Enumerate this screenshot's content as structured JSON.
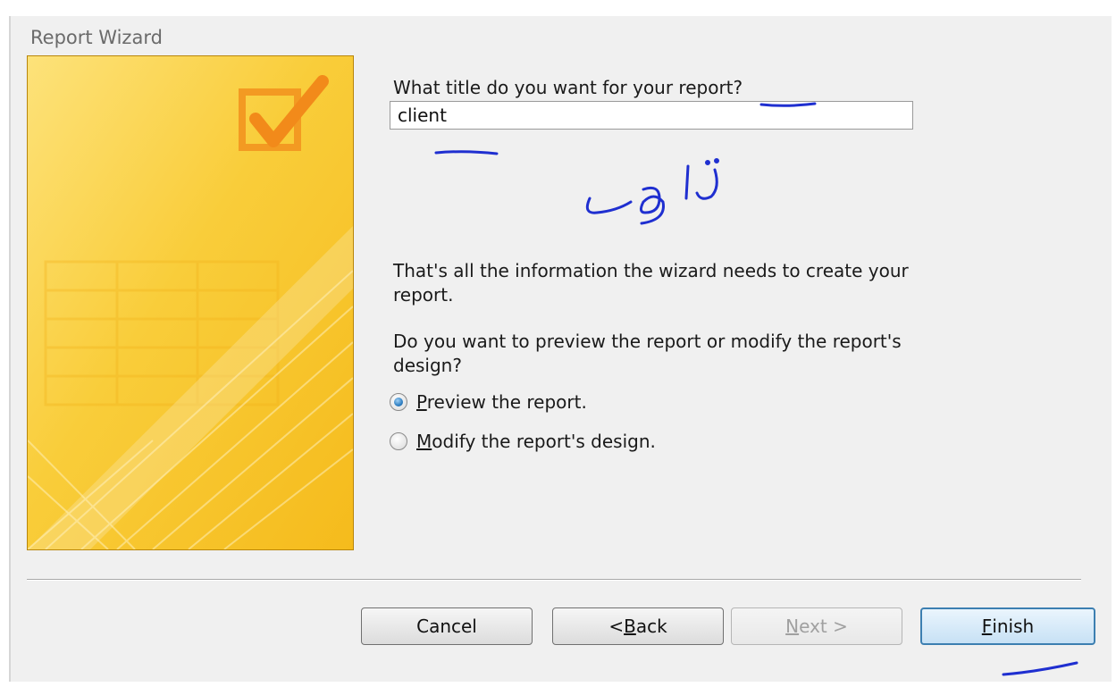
{
  "window": {
    "title": "Report Wizard"
  },
  "prompts": {
    "title_question": "What title do you want for your report?",
    "info_line1": "That's all the information the wizard needs to create your",
    "info_line2": "report.",
    "preview_question_line1": "Do you want to preview the report or modify the report's",
    "preview_question_line2": "design?"
  },
  "title_field": {
    "value": "client"
  },
  "options": [
    {
      "prefix": "",
      "hotkey": "P",
      "rest": "review the report.",
      "checked": true
    },
    {
      "prefix": "",
      "hotkey": "M",
      "rest": "odify the report's design.",
      "checked": false
    }
  ],
  "buttons": {
    "cancel": {
      "label": "Cancel"
    },
    "back": {
      "prefix": "< ",
      "hotkey": "B",
      "rest": "ack"
    },
    "next": {
      "hotkey": "N",
      "rest": "ext >",
      "enabled": false
    },
    "finish": {
      "hotkey": "F",
      "rest": "inish"
    }
  },
  "annotation": {
    "handwritten": "عنوان",
    "ink_color": "#1f2fd0"
  },
  "colors": {
    "banner_yellow": "#f7c62c",
    "banner_orange": "#f29a22",
    "accent_blue": "#3c7fb1"
  }
}
